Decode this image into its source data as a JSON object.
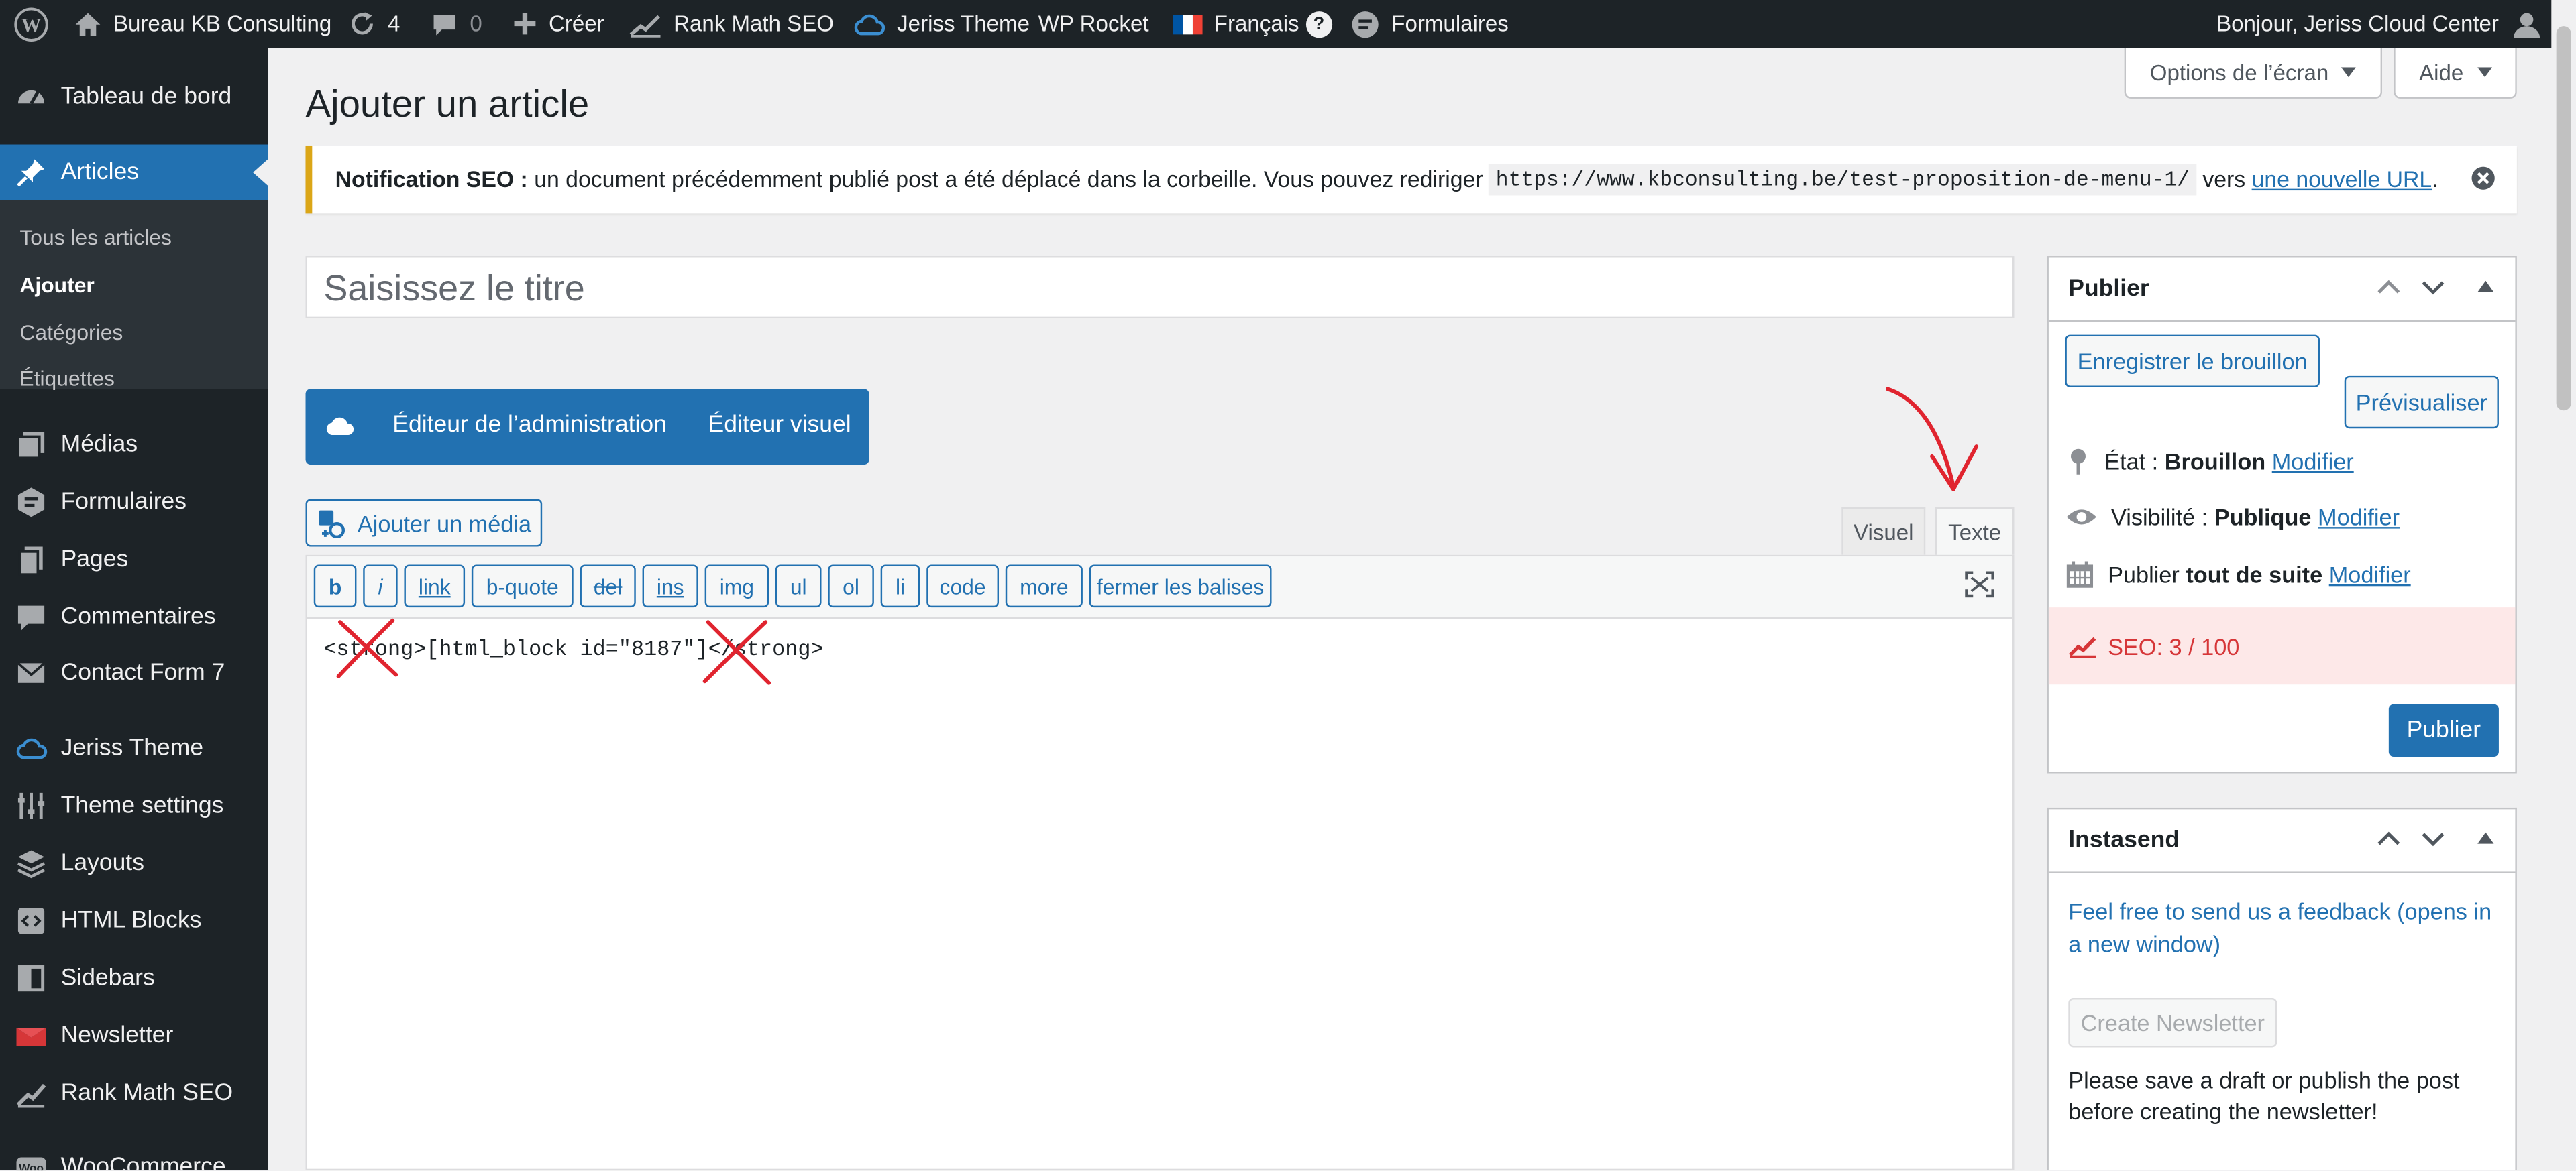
{
  "admin_bar": {
    "site_name": "Bureau KB Consulting",
    "updates_count": "4",
    "comments_count": "0",
    "new_label": "Créer",
    "rank_math_label": "Rank Math SEO",
    "jeriss_label": "Jeriss Theme",
    "wp_rocket_label": "WP Rocket",
    "language_label": "Français",
    "help_glyph": "?",
    "forms_label": "Formulaires",
    "greeting": "Bonjour, Jeriss Cloud Center"
  },
  "screen_options": {
    "options_label": "Options de l’écran",
    "help_label": "Aide"
  },
  "sidebar": {
    "dashboard": "Tableau de bord",
    "posts": "Articles",
    "posts_sub": [
      "Tous les articles",
      "Ajouter",
      "Catégories",
      "Étiquettes"
    ],
    "items": [
      "Médias",
      "Formulaires",
      "Pages",
      "Commentaires",
      "Contact Form 7",
      "Jeriss Theme",
      "Theme settings",
      "Layouts",
      "HTML Blocks",
      "Sidebars",
      "Newsletter",
      "Rank Math SEO",
      "WooCommerce"
    ]
  },
  "page": {
    "title": "Ajouter un article"
  },
  "notice": {
    "strong": "Notification SEO :",
    "text": " un document précédemment publié post a été déplacé dans la corbeille. Vous pouvez rediriger ",
    "url": "https://www.kbconsulting.be/test-proposition-de-menu-1/",
    "text2": " vers ",
    "link": "une nouvelle URL",
    "end": "."
  },
  "editor": {
    "title_placeholder": "Saisissez le titre",
    "admin_editor_label": "Éditeur de l’administration",
    "visual_editor_label": "Éditeur visuel",
    "add_media_label": "Ajouter un média",
    "tab_visual": "Visuel",
    "tab_text": "Texte",
    "quicktags": [
      "b",
      "i",
      "link",
      "b-quote",
      "del",
      "ins",
      "img",
      "ul",
      "ol",
      "li",
      "code",
      "more",
      "fermer les balises"
    ],
    "content": "<strong>[html_block id=\"8187\"]</strong>"
  },
  "publish_box": {
    "title": "Publier",
    "save_draft": "Enregistrer le brouillon",
    "preview": "Prévisualiser",
    "status_label": "État :",
    "status_value": "Brouillon",
    "visibility_label": "Visibilité :",
    "visibility_value": "Publique",
    "publish_label": "Publier",
    "publish_value": "tout de suite",
    "modify": "Modifier",
    "seo_score": "SEO: 3 / 100",
    "publish_button": "Publier"
  },
  "instasend_box": {
    "title": "Instasend",
    "feedback_link": "Feel free to send us a feedback (opens in a new window)",
    "create_button": "Create Newsletter",
    "notice": "Please save a draft or publish the post before creating the newsletter!"
  },
  "colors": {
    "accent": "#2271b1",
    "sidebar_bg": "#1d2327",
    "seo_bad": "#d63638",
    "annotation": "#e0242f"
  }
}
